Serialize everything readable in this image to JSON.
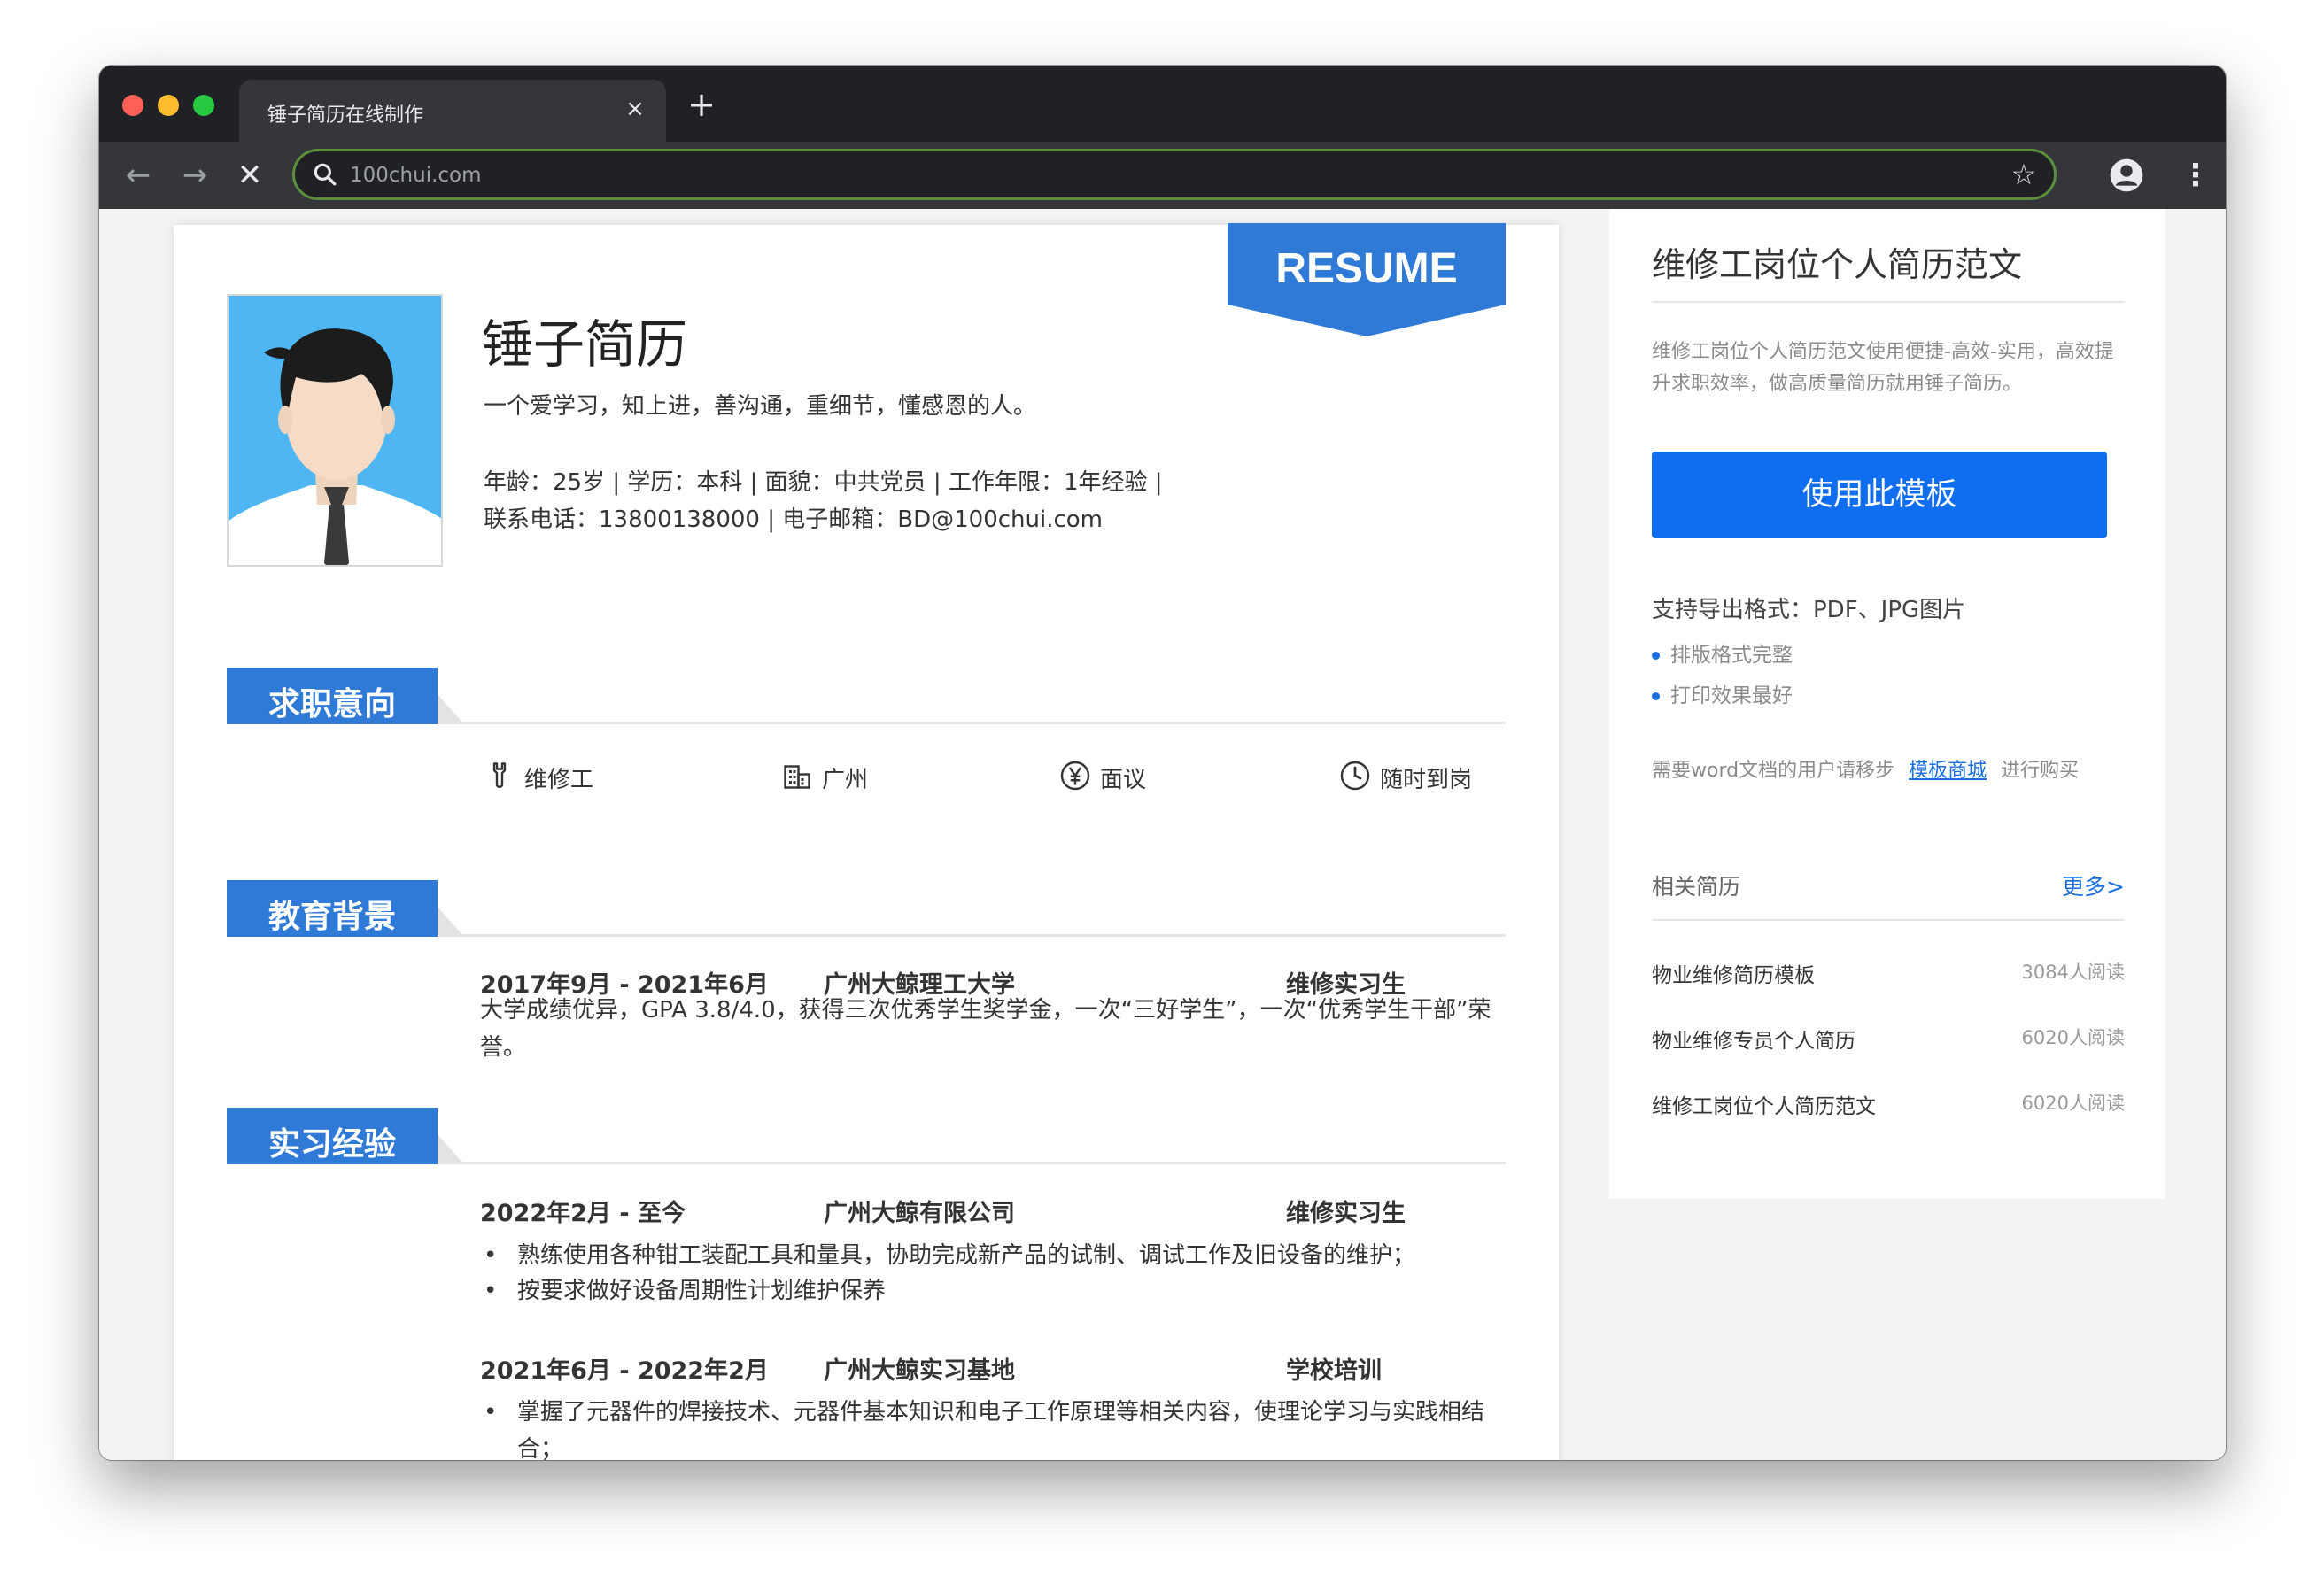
{
  "browser": {
    "tab_title": "锤子简历在线制作",
    "tab_close": "×",
    "new_tab": "+",
    "url": "100chui.com",
    "back": "←",
    "forward": "→",
    "stop": "✕",
    "star": "☆",
    "menu": "⋮"
  },
  "resume": {
    "ribbon": "RESUME",
    "name": "锤子简历",
    "motto": "一个爱学习，知上进，善沟通，重细节，懂感恩的人。",
    "info_line1": "年龄：25岁 | 学历：本科 | 面貌：中共党员 | 工作年限：1年经验 |",
    "info_line2": "联系电话：13800138000 | 电子邮箱：BD@100chui.com",
    "sections": {
      "intent": "求职意向",
      "education": "教育背景",
      "internship": "实习经验"
    },
    "intent": {
      "position": "维修工",
      "city": "广州",
      "salary": "面议",
      "availability": "随时到岗"
    },
    "education": {
      "period": "2017年9月 - 2021年6月",
      "school": "广州大鲸理工大学",
      "role": "维修实习生",
      "desc": "大学成绩优异，GPA 3.8/4.0，获得三次优秀学生奖学金，一次“三好学生”，一次“优秀学生干部”荣誉。"
    },
    "internships": [
      {
        "period": "2022年2月 - 至今",
        "company": "广州大鲸有限公司",
        "role": "维修实习生",
        "bullets": [
          "熟练使用各种钳工装配工具和量具，协助完成新产品的试制、调试工作及旧设备的维护；",
          "按要求做好设备周期性计划维护保养"
        ]
      },
      {
        "period": "2021年6月 - 2022年2月",
        "company": "广州大鲸实习基地",
        "role": "学校培训",
        "bullets": [
          "掌握了元器件的焊接技术、元器件基本知识和电子工作原理等相关内容，使理论学习与实践相结合；"
        ]
      }
    ],
    "bullet_char": "•"
  },
  "sidebar": {
    "title": "维修工岗位个人简历范文",
    "desc": "维修工岗位个人简历范文使用便捷-高效-实用，高效提升求职效率，做高质量简历就用锤子简历。",
    "use_button": "使用此模板",
    "formats": "支持导出格式：PDF、JPG图片",
    "features": [
      "排版格式完整",
      "打印效果最好"
    ],
    "word_prefix": "需要word文档的用户请移步",
    "word_link": "模板商城",
    "word_suffix": "进行购买",
    "related_label": "相关简历",
    "more_label": "更多>",
    "related": [
      {
        "name": "物业维修简历模板",
        "reads": "3084人阅读"
      },
      {
        "name": "物业维修专员个人简历",
        "reads": "6020人阅读"
      },
      {
        "name": "维修工岗位个人简历范文",
        "reads": "6020人阅读"
      }
    ]
  },
  "colors": {
    "accent": "#2e7ad6",
    "button": "#0f6ef0",
    "link": "#1a6fe0",
    "chrome_dark": "#202124",
    "chrome_toolbar": "#35363a"
  },
  "icons": {
    "position": "wrench-icon",
    "city": "building-icon",
    "salary": "yen-icon",
    "availability": "clock-icon",
    "search": "search-icon",
    "profile": "account-icon"
  }
}
